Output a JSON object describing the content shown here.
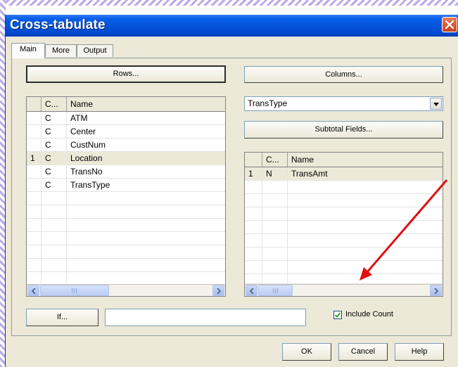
{
  "window": {
    "title": "Cross-tabulate"
  },
  "tabs": [
    "Main",
    "More",
    "Output"
  ],
  "buttons": {
    "rows": "Rows...",
    "columns": "Columns...",
    "subtotal": "Subtotal Fields...",
    "if": "If...",
    "ok": "OK",
    "cancel": "Cancel",
    "help": "Help"
  },
  "columns_field": {
    "selected": "TransType"
  },
  "rows_grid": {
    "headers": [
      "",
      "C...",
      "Name"
    ],
    "rows": [
      [
        "",
        "C",
        "ATM"
      ],
      [
        "",
        "C",
        "Center"
      ],
      [
        "",
        "C",
        "CustNum"
      ],
      [
        "1",
        "C",
        "Location"
      ],
      [
        "",
        "C",
        "TransNo"
      ],
      [
        "",
        "C",
        "TransType"
      ]
    ],
    "selected_row": 3
  },
  "subtotal_grid": {
    "headers": [
      "",
      "C...",
      "Name"
    ],
    "rows": [
      [
        "1",
        "N",
        "TransAmt"
      ]
    ],
    "selected_row": 0
  },
  "if_field": {
    "value": ""
  },
  "include_count": {
    "label": "Include Count",
    "checked": true
  },
  "colors": {
    "titlebar": "#0355da",
    "dialog": "#ece9d8",
    "annotation_arrow": "#e01010",
    "close": "#c8431d"
  },
  "icons": [
    "close-icon",
    "dropdown-arrow-icon",
    "scroll-left-icon",
    "scroll-right-icon",
    "checkmark-icon"
  ]
}
